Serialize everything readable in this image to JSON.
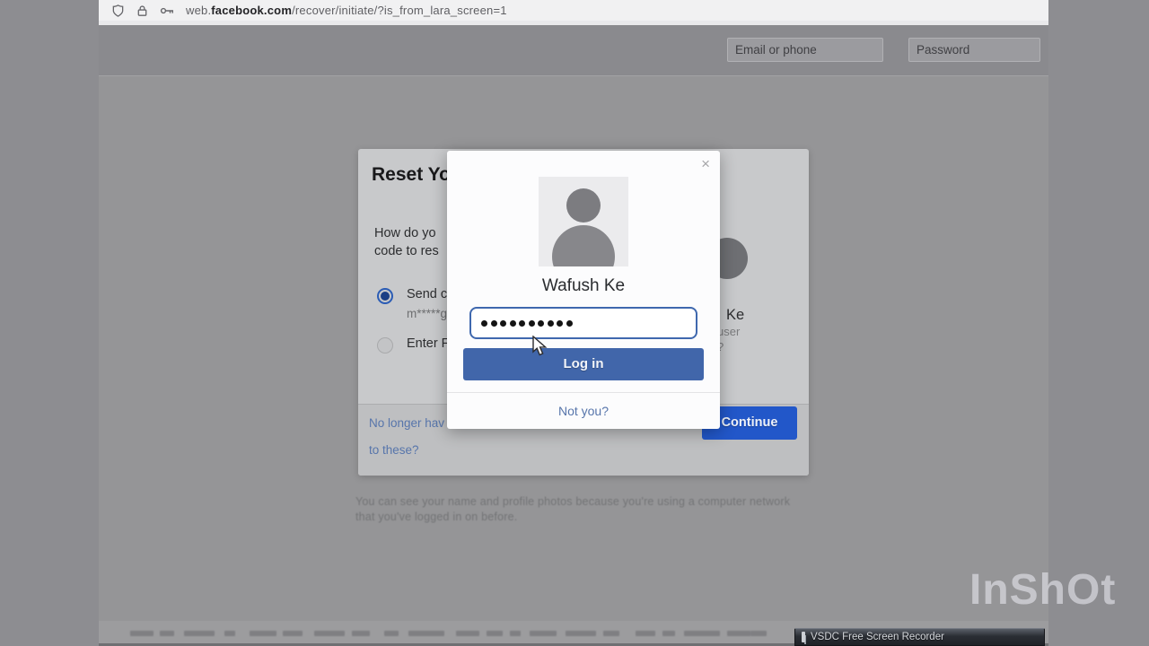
{
  "browser": {
    "url_prefix": "web.",
    "url_domain": "facebook.com",
    "url_path": "/recover/initiate/?is_from_lara_screen=1"
  },
  "header": {
    "email_placeholder": "Email or phone",
    "password_placeholder": "Password"
  },
  "reset_dialog": {
    "title_fragment": "Reset Yo",
    "question_line1": "How do yo",
    "question_line2": "code to res",
    "option1_label": "Send c",
    "option1_sub": "m*****g",
    "option2_label": "Enter F",
    "account_name_fragment": "Ke",
    "account_sub_fragment": "user",
    "account_sub2_fragment": "?",
    "no_access_line1": "No longer hav",
    "no_access_line2": "to these?",
    "continue_label": "Continue"
  },
  "page_note": {
    "line1": "You can see your name and profile photos because you're using a computer network",
    "line2": "that you've logged in on before."
  },
  "login_modal": {
    "close_glyph": "×",
    "name": "Wafush Ke",
    "password_dots": 10,
    "login_label": "Log in",
    "not_you_label": "Not you?"
  },
  "taskbar": {
    "vsdc_label": "VSDC Free Screen Recorder"
  },
  "watermark_text": "InShOt",
  "colors": {
    "accent-blue": "#4166aa",
    "continue-blue": "#2257c9",
    "link-blue": "#5775ab",
    "input-border-blue": "#3f68ae",
    "radio-blue": "#2b5cb5",
    "radio-center": "#1b3f85"
  }
}
